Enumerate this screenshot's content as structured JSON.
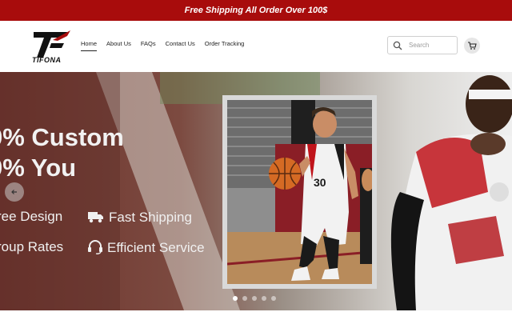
{
  "announcement": {
    "text": "Free Shipping All Order Over 100$"
  },
  "brand": {
    "name": "TIFONA",
    "accent_color": "#a80c0c"
  },
  "nav": {
    "items": [
      {
        "label": "Home",
        "active": true
      },
      {
        "label": "About Us",
        "active": false
      },
      {
        "label": "FAQs",
        "active": false
      },
      {
        "label": "Contact Us",
        "active": false
      },
      {
        "label": "Order Tracking",
        "active": false
      }
    ]
  },
  "search": {
    "placeholder": "Search",
    "icon": "search-icon"
  },
  "cart": {
    "icon": "cart-icon"
  },
  "hero": {
    "title_line1": "0% Custom",
    "title_line2": "0% You",
    "features": [
      {
        "label": "ree Design",
        "icon": ""
      },
      {
        "label": "Fast Shipping",
        "icon": "truck-icon"
      },
      {
        "label": "roup Rates",
        "icon": ""
      },
      {
        "label": "Efficient Service",
        "icon": "headset-icon"
      }
    ],
    "jersey_number": "30",
    "slides_total": 5,
    "active_slide": 1
  }
}
